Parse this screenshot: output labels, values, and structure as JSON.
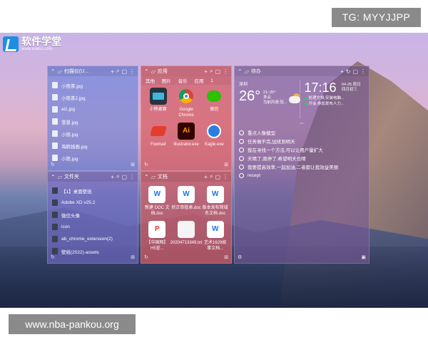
{
  "watermarks": {
    "tg": "TG: MYYJJPP",
    "url": "www.nba-pankou.org"
  },
  "logo": {
    "cn": "软件学堂",
    "en": "www.xue51.com"
  },
  "fences": {
    "files1": {
      "title": "扫描仪(U...",
      "items": [
        {
          "label": "小熊茶.jpg",
          "icon": "image-file-icon"
        },
        {
          "label": "小熊茶2.jpg",
          "icon": "image-file-icon"
        },
        {
          "label": "ai1.jpg",
          "icon": "image-file-icon"
        },
        {
          "label": "雪景.jpg",
          "icon": "image-file-icon"
        },
        {
          "label": "小熊.jpg",
          "icon": "image-file-icon"
        },
        {
          "label": "海鸥插画.jpg",
          "icon": "image-file-icon"
        },
        {
          "label": "小熊.jpg",
          "icon": "image-file-icon"
        }
      ]
    },
    "apps": {
      "title": "应用",
      "tabs": [
        "其他",
        "图片",
        "音乐",
        "应用",
        "1"
      ],
      "items": [
        {
          "label": "小熊桌面",
          "icon": "desktop-app-icon"
        },
        {
          "label": "Google Chrome",
          "icon": "chrome-icon"
        },
        {
          "label": "微信",
          "icon": "wechat-icon"
        },
        {
          "label": "Foxmail",
          "icon": "foxmail-icon"
        },
        {
          "label": "Illustrator.exe",
          "icon": "illustrator-icon"
        },
        {
          "label": "Eagle.exe",
          "icon": "eagle-icon"
        }
      ]
    },
    "folders": {
      "title": "文件夹",
      "items": [
        {
          "label": "【1】桌面壁纸",
          "icon": "folder-icon"
        },
        {
          "label": "Adobe XD v25.2",
          "icon": "folder-icon"
        },
        {
          "label": "微信头像",
          "icon": "folder-icon"
        },
        {
          "label": "icon",
          "icon": "folder-icon"
        },
        {
          "label": "ab_chrome_extension(2)",
          "icon": "folder-icon"
        },
        {
          "label": "壁纸(2022)-assets",
          "icon": "folder-icon"
        }
      ]
    },
    "docs": {
      "title": "文档",
      "items": [
        {
          "label": "新建 DOC 文档.doc",
          "icon": "wps-doc-icon"
        },
        {
          "label": "转正审批表.doc",
          "icon": "wps-doc-icon"
        },
        {
          "label": "版本发布简域名文档.doc",
          "icon": "wps-doc-icon"
        },
        {
          "label": "【中国网】H5宣...",
          "icon": "pdf-icon"
        },
        {
          "label": "20204713349.txt",
          "icon": "text-file-icon"
        },
        {
          "label": "艺术1629故事文档...",
          "icon": "wps-doc-icon"
        }
      ]
    },
    "todo": {
      "title": "待办",
      "weather": {
        "city": "深圳",
        "temp": "26°",
        "range": "21~25°",
        "cond": "多云",
        "desc": "当前风速:轻..."
      },
      "clock": {
        "time": "17:16",
        "date": "04-26 周日",
        "lunar": "四月初三"
      },
      "events": [
        "处理文档,安装电脑...",
        "开会,参加发布人力..."
      ],
      "tasks": [
        "重点人像模型",
        "任务做不完,加班到明天",
        "我在寻找一个方法,可以让用户量扩大",
        "天晴了,雨停了,希望明天也晴",
        "我要提高效率,一起加油,二者都让我效益美丽",
        "recept"
      ]
    }
  }
}
